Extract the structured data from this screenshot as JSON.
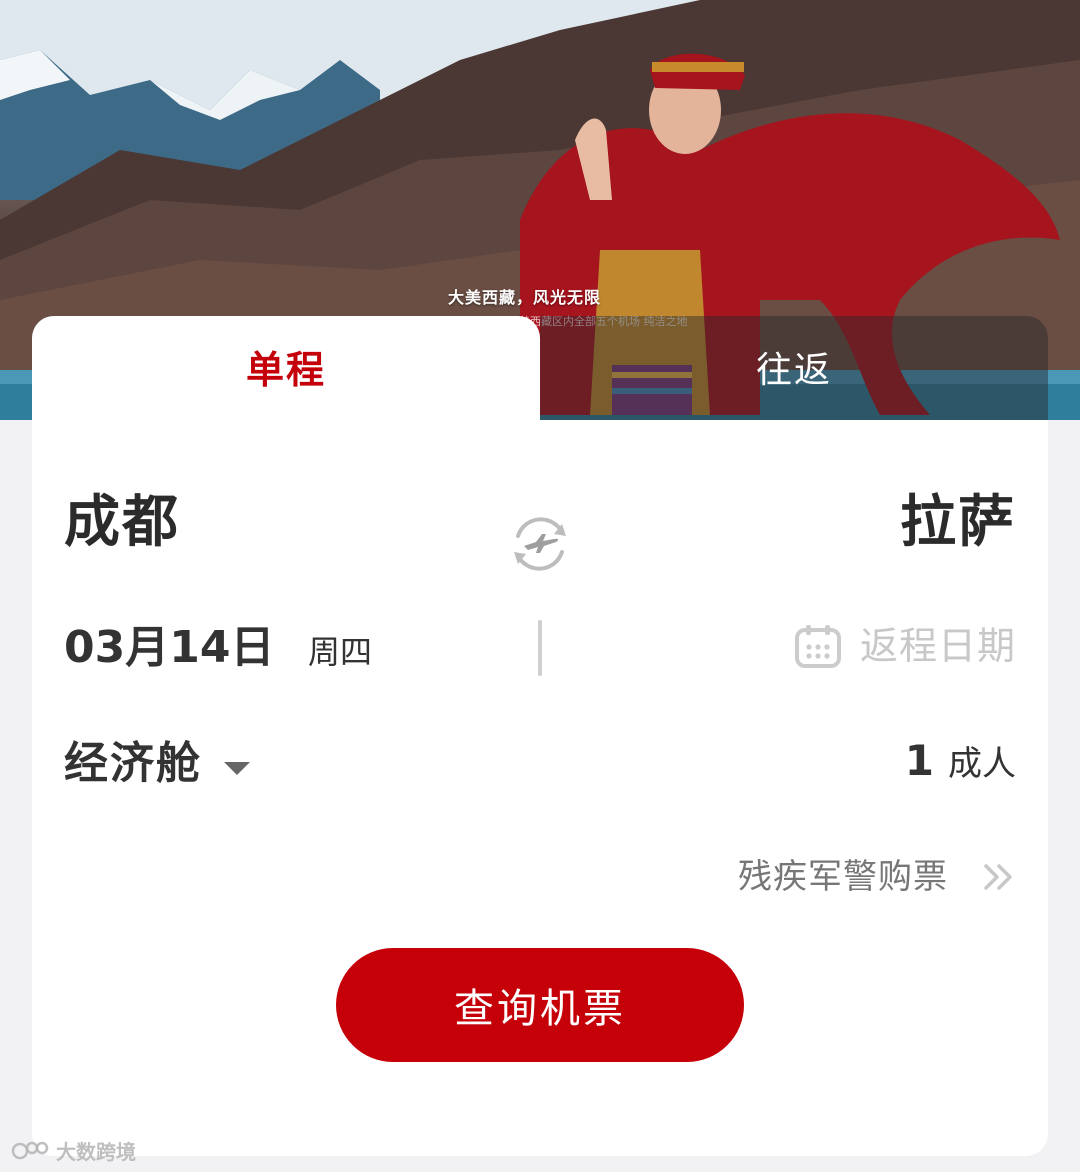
{
  "hero": {
    "caption": "大美西藏，风光无限",
    "subcaption": "覆盖西藏区内全部五个机场 纯洁之地"
  },
  "tabs": {
    "one_way": "单程",
    "round_trip": "往返"
  },
  "route": {
    "origin": "成都",
    "destination": "拉萨"
  },
  "dates": {
    "depart_date": "03月14日",
    "depart_weekday": "周四",
    "return_placeholder": "返程日期"
  },
  "cabin": {
    "selected": "经济舱"
  },
  "passengers": {
    "count": "1",
    "type": "成人"
  },
  "special": {
    "label": "残疾军警购票"
  },
  "search": {
    "label": "查询机票"
  },
  "watermark": {
    "label": "大数跨境"
  },
  "colors": {
    "accent": "#c60008",
    "text": "#333333",
    "muted": "#c8c8c8"
  }
}
